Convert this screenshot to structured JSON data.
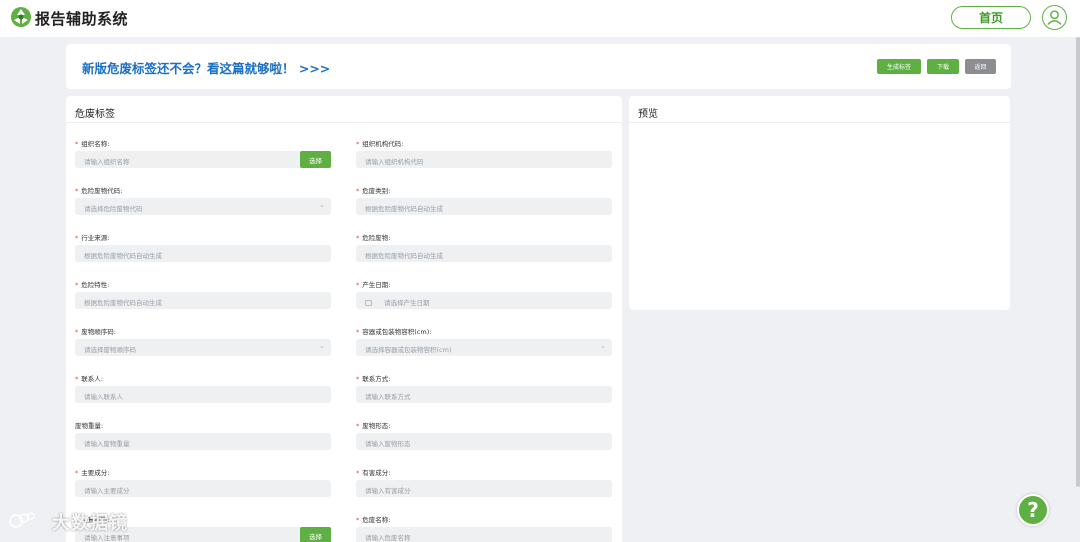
{
  "header": {
    "app_title": "报告辅助系统",
    "home_label": "首页",
    "logo_icon": "green-recycle-logo",
    "user_icon": "user-icon"
  },
  "banner": {
    "link_text": "新版危废标签还不会？看这篇就够啦！ >>>",
    "buttons": {
      "generate": "生成标签",
      "download": "下载",
      "back": "返回"
    }
  },
  "form_panel": {
    "title": "危废标签",
    "select_label": "选择",
    "fields": [
      {
        "label": "组织名称:",
        "required": true,
        "placeholder": "请输入组织名称"
      },
      {
        "label": "组织机构代码:",
        "required": true,
        "placeholder": "请输入组织机构代码"
      },
      {
        "label": "危险废物代码:",
        "required": true,
        "placeholder": "请选择危险废物代码"
      },
      {
        "label": "危废类别:",
        "required": true,
        "placeholder": "根据危险废物代码自动生成"
      },
      {
        "label": "行业来源:",
        "required": true,
        "placeholder": "根据危险废物代码自动生成"
      },
      {
        "label": "危险废物:",
        "required": true,
        "placeholder": "根据危险废物代码自动生成"
      },
      {
        "label": "危险特性:",
        "required": true,
        "placeholder": "根据危险废物代码自动生成"
      },
      {
        "label": "产生日期:",
        "required": true,
        "placeholder": "请选择产生日期"
      },
      {
        "label": "废物顺序码:",
        "required": true,
        "placeholder": "请选择废物顺序码"
      },
      {
        "label": "容器或包装物容积(cm):",
        "required": true,
        "placeholder": "请选择容器或包装物容积(cm)"
      },
      {
        "label": "联系人:",
        "required": true,
        "placeholder": "请输入联系人"
      },
      {
        "label": "联系方式:",
        "required": true,
        "placeholder": "请输入联系方式"
      },
      {
        "label": "废物重量:",
        "required": false,
        "placeholder": "请输入废物重量"
      },
      {
        "label": "废物形态:",
        "required": true,
        "placeholder": "请输入废物形态"
      },
      {
        "label": "主要成分:",
        "required": true,
        "placeholder": "请输入主要成分"
      },
      {
        "label": "有害成分:",
        "required": true,
        "placeholder": "请输入有害成分"
      },
      {
        "label": "注意事项:",
        "required": true,
        "placeholder": "请输入注意事项"
      },
      {
        "label": "危废名称:",
        "required": true,
        "placeholder": "请输入危废名称"
      }
    ]
  },
  "preview_panel": {
    "title": "预览"
  },
  "watermark": {
    "text": "大数据镜"
  },
  "help_icon": "help-question-icon",
  "colors": {
    "accent_green": "#5fb043",
    "link_blue": "#1a6fc4",
    "required_red": "#e2483d",
    "page_bg": "#eef0f3"
  }
}
